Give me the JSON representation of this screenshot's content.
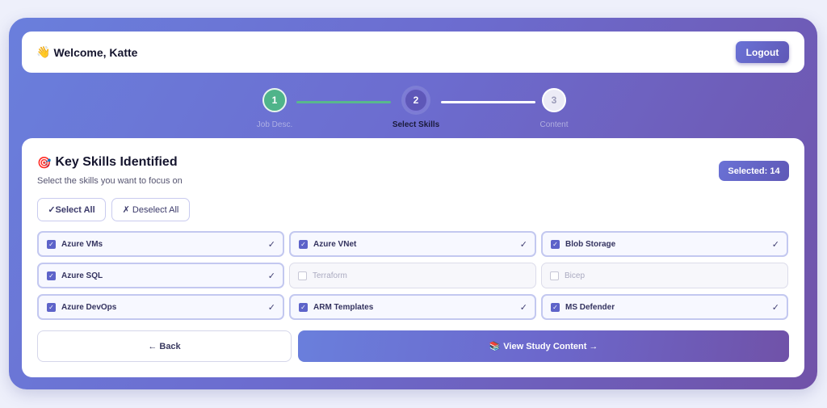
{
  "header": {
    "wave_emoji": "👋",
    "welcome_text": "Welcome, Katte",
    "logout_label": "Logout"
  },
  "stepper": {
    "steps": [
      {
        "number": "1",
        "label": "Job Desc.",
        "state": "completed"
      },
      {
        "number": "2",
        "label": "Select Skills",
        "state": "active"
      },
      {
        "number": "3",
        "label": "Content",
        "state": "pending"
      }
    ]
  },
  "card": {
    "title_emoji": "🎯",
    "title": "Key Skills Identified",
    "subtitle": "Select the skills you want to focus on",
    "selected_badge": "Selected: 14",
    "select_all_label": "✓Select All",
    "deselect_all_label": "✗ Deselect All",
    "skills": [
      {
        "name": "Azure VMs",
        "checked": true
      },
      {
        "name": "Azure VNet",
        "checked": true
      },
      {
        "name": "Blob Storage",
        "checked": true
      },
      {
        "name": "Azure SQL",
        "checked": true
      },
      {
        "name": "Terraform",
        "checked": false
      },
      {
        "name": "Bicep",
        "checked": false
      },
      {
        "name": "Azure DevOps",
        "checked": true
      },
      {
        "name": "ARM Templates",
        "checked": true
      },
      {
        "name": "MS Defender",
        "checked": true
      }
    ],
    "back_label": "← Back",
    "next_emoji": "📚",
    "next_label": "View Study Content →"
  },
  "colors": {
    "accent": "#5f58b6",
    "success": "#4fb48a",
    "gradient_start": "#6a7fdc",
    "gradient_end": "#7052a8"
  }
}
